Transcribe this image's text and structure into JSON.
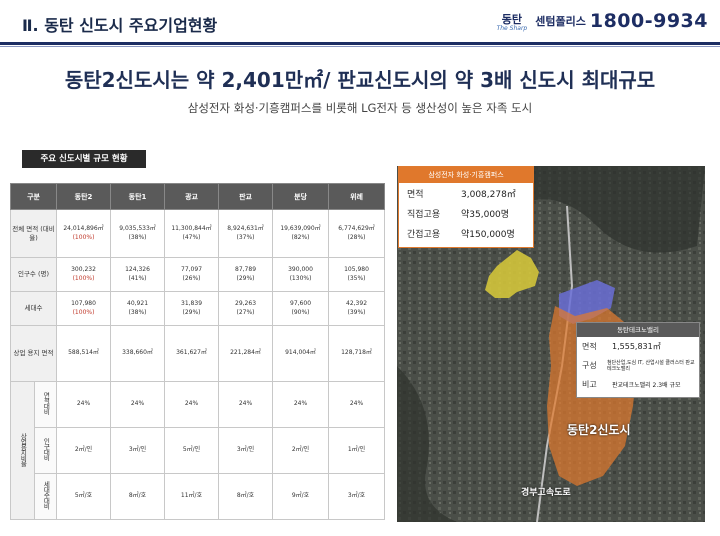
{
  "header": {
    "section_title": "Ⅱ. 동탄 신도시 주요기업현황",
    "brand_logo": "동탄",
    "brand_sub": "The Sharp",
    "brand_name": "센텀폴리스",
    "brand_phone": "1800-9934"
  },
  "headline": "동탄2신도시는 약 2,401만㎡/ 판교신도시의 약 3배 신도시 최대규모",
  "subheadline": "삼성전자 화성·기흥캠퍼스를 비롯해 LG전자 등 생산성이 높은 자족 도시",
  "table": {
    "label": "주요 신도시별 규모 현황",
    "columns": [
      "구분",
      "동탄2",
      "동탄1",
      "광교",
      "판교",
      "분당",
      "위례"
    ],
    "rows": [
      {
        "head": "전체 면적 (대비율)",
        "cells": [
          [
            "24,014,896㎡",
            "(100%)"
          ],
          [
            "9,035,533㎡",
            "(38%)"
          ],
          [
            "11,300,844㎡",
            "(47%)"
          ],
          [
            "8,924,631㎡",
            "(37%)"
          ],
          [
            "19,639,090㎡",
            "(82%)"
          ],
          [
            "6,774,629㎡",
            "(28%)"
          ]
        ]
      },
      {
        "head": "인구수 (명)",
        "cells": [
          [
            "300,232",
            "(100%)"
          ],
          [
            "124,326",
            "(41%)"
          ],
          [
            "77,097",
            "(26%)"
          ],
          [
            "87,789",
            "(29%)"
          ],
          [
            "390,000",
            "(130%)"
          ],
          [
            "105,980",
            "(35%)"
          ]
        ]
      },
      {
        "head": "세대수",
        "cells": [
          [
            "107,980",
            "(100%)"
          ],
          [
            "40,921",
            "(38%)"
          ],
          [
            "31,839",
            "(29%)"
          ],
          [
            "29,263",
            "(27%)"
          ],
          [
            "97,600",
            "(90%)"
          ],
          [
            "42,392",
            "(39%)"
          ]
        ]
      },
      {
        "head": "상업 용지 면적",
        "cells": [
          [
            "588,514㎡"
          ],
          [
            "338,660㎡"
          ],
          [
            "361,627㎡"
          ],
          [
            "221,284㎡"
          ],
          [
            "914,004㎡"
          ],
          [
            "128,718㎡"
          ]
        ]
      }
    ],
    "group_head": "상업용지비율",
    "subrows": [
      {
        "head": "면적대비",
        "cells": [
          "24%",
          "24%",
          "24%",
          "24%",
          "24%",
          "24%"
        ]
      },
      {
        "head": "인구대비",
        "cells": [
          "2㎡/인",
          "3㎡/인",
          "5㎡/인",
          "3㎡/인",
          "2㎡/인",
          "1㎡/인"
        ]
      },
      {
        "head": "세대수대비",
        "cells": [
          "5㎡/호",
          "8㎡/호",
          "11㎡/호",
          "8㎡/호",
          "9㎡/호",
          "3㎡/호"
        ]
      }
    ]
  },
  "samsung_box": {
    "title": "삼성전자 화성·기흥캠퍼스",
    "rows": [
      {
        "k": "면적",
        "v": "3,008,278㎡"
      },
      {
        "k": "직접고용",
        "v": "약35,000명"
      },
      {
        "k": "간접고용",
        "v": "약150,000명"
      }
    ]
  },
  "techno_box": {
    "title": "동탄테크노밸리",
    "rows": [
      {
        "k": "면적",
        "v": "1,555,831㎡"
      },
      {
        "k": "구성",
        "v": "첨단산업,도심 IT, 산업시설 클러스터 판교테크노밸리"
      },
      {
        "k": "비고",
        "v": "판교테크노밸리 2.3배 규모"
      }
    ]
  },
  "map": {
    "district_label": "동탄2신도시",
    "road_label": "경부고속도로",
    "colors": {
      "samsung": "#d6c83a",
      "techno": "#6a6ed6",
      "dongtan2": "#e07a2e"
    }
  }
}
